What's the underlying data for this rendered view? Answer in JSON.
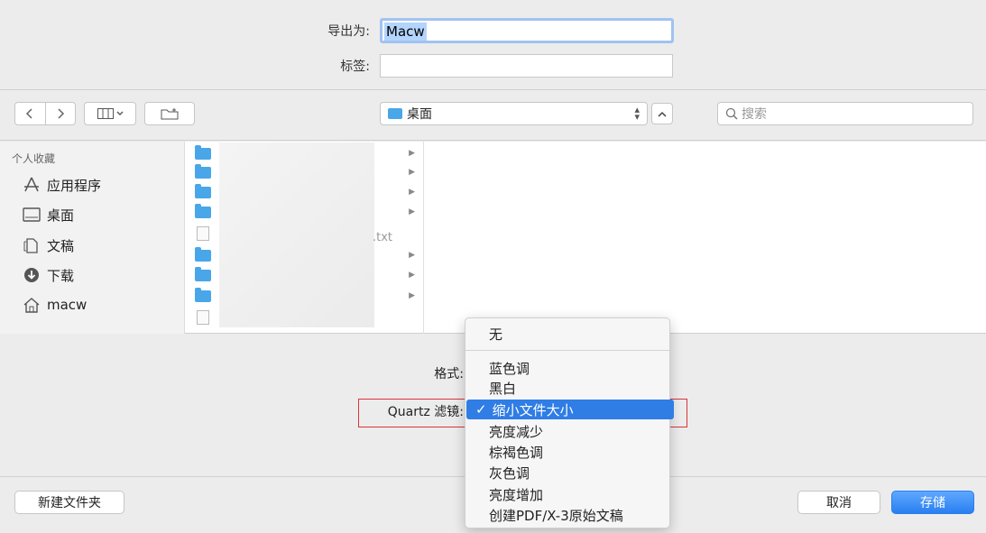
{
  "save_panel": {
    "save_as_label": "导出为:",
    "save_as_value": "Macw",
    "tags_label": "标签:",
    "tags_value": ""
  },
  "toolbar": {
    "back_icon": "chevron-left-icon",
    "forward_icon": "chevron-right-icon",
    "view_icon": "column-view-icon",
    "new_folder_icon": "new-folder-icon",
    "location": "桌面",
    "search_placeholder": "搜索"
  },
  "sidebar": {
    "header": "个人收藏",
    "items": [
      {
        "label": "应用程序",
        "icon": "applications-icon"
      },
      {
        "label": "桌面",
        "icon": "desktop-icon"
      },
      {
        "label": "文稿",
        "icon": "documents-icon"
      },
      {
        "label": "下载",
        "icon": "downloads-icon"
      },
      {
        "label": "macw",
        "icon": "home-icon"
      }
    ]
  },
  "files": {
    "txt_suffix": ".txt"
  },
  "options": {
    "format_label": "格式:",
    "quartz_label": "Quartz 滤镜:"
  },
  "menu": {
    "items": [
      "无",
      "蓝色调",
      "黑白",
      "缩小文件大小",
      "亮度减少",
      "棕褐色调",
      "灰色调",
      "亮度增加",
      "创建PDF/X-3原始文稿"
    ],
    "selected_index": 3,
    "check": "✓"
  },
  "buttons": {
    "new_folder": "新建文件夹",
    "cancel": "取消",
    "save": "存储"
  },
  "colors": {
    "accent": "#2f7de5",
    "highlight_border": "#d9343a",
    "folder": "#49a6e8"
  }
}
